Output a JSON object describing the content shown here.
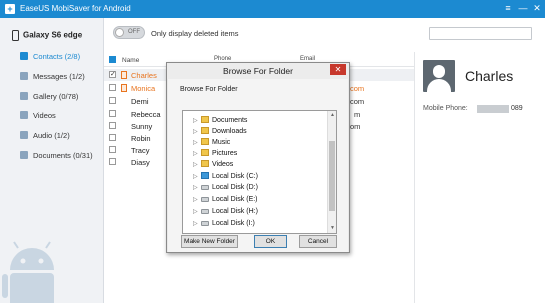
{
  "app": {
    "title": "EaseUS MobiSaver for Android"
  },
  "window_controls": {
    "menu": "≡",
    "minimize": "—",
    "close": "✕"
  },
  "sidebar": {
    "device_name": "Galaxy S6 edge",
    "items": [
      {
        "label": "Contacts (2/8)",
        "active": true
      },
      {
        "label": "Messages (1/2)"
      },
      {
        "label": "Gallery (0/78)"
      },
      {
        "label": "Videos"
      },
      {
        "label": "Audio (1/2)"
      },
      {
        "label": "Documents (0/31)"
      }
    ]
  },
  "toolbar": {
    "toggle_state": "OFF",
    "toggle_label": "Only display deleted items",
    "search_placeholder": ""
  },
  "table": {
    "columns": {
      "name": "Name",
      "phone": "Phone",
      "email": "Email"
    },
    "rows": [
      {
        "name": "Charles",
        "checked": true,
        "deleted": true,
        "selected": true
      },
      {
        "name": "Monica",
        "checked": false,
        "deleted": true
      },
      {
        "name": "Demi"
      },
      {
        "name": "Rebecca"
      },
      {
        "name": "Sunny"
      },
      {
        "name": "Robin"
      },
      {
        "name": "Tracy"
      },
      {
        "name": "Diasy"
      }
    ],
    "email_fragments": [
      "com",
      "com",
      "m",
      "om"
    ]
  },
  "detail": {
    "name": "Charles",
    "phone_label": "Mobile Phone:",
    "phone_suffix": "089"
  },
  "dialog": {
    "title": "Browse For Folder",
    "heading": "Browse For Folder",
    "close": "✕",
    "tree": [
      {
        "label": "Documents",
        "icon": "folder"
      },
      {
        "label": "Downloads",
        "icon": "folder"
      },
      {
        "label": "Music",
        "icon": "folder"
      },
      {
        "label": "Pictures",
        "icon": "folder"
      },
      {
        "label": "Videos",
        "icon": "folder"
      },
      {
        "label": "Local Disk (C:)",
        "icon": "system-disk"
      },
      {
        "label": "Local Disk (D:)",
        "icon": "disk"
      },
      {
        "label": "Local Disk (E:)",
        "icon": "disk"
      },
      {
        "label": "Local Disk (H:)",
        "icon": "disk"
      },
      {
        "label": "Local Disk (I:)",
        "icon": "disk"
      }
    ],
    "buttons": {
      "make_new_folder": "Make New Folder",
      "ok": "OK",
      "cancel": "Cancel"
    }
  },
  "colors": {
    "accent": "#1c8ad1",
    "deleted": "#e8741f",
    "close_red": "#c7382c"
  }
}
